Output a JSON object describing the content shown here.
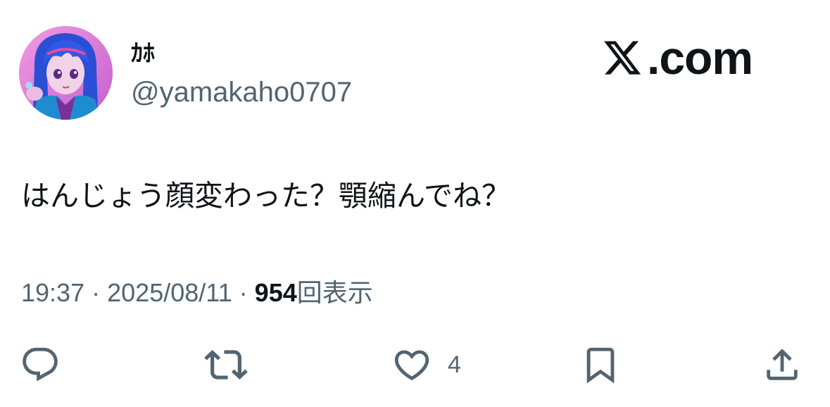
{
  "author": {
    "display_name": "ｶﾎ",
    "handle": "@yamakaho0707",
    "avatar_icon": "anime-avatar-icon"
  },
  "brand": {
    "logo_text": ".com",
    "logo_icon": "x-logo-icon"
  },
  "tweet": {
    "text": "はんじょう顔変わった？顎縮んでね？"
  },
  "meta": {
    "time": "19:37",
    "separator": "·",
    "date": "2025/08/11",
    "views_count": "954",
    "views_label": "回表示"
  },
  "actions": {
    "reply_icon": "reply-icon",
    "retweet_icon": "retweet-icon",
    "like_icon": "heart-icon",
    "like_count": "4",
    "bookmark_icon": "bookmark-icon",
    "share_icon": "share-icon"
  },
  "colors": {
    "text_primary": "#0f1419",
    "text_secondary": "#536471",
    "background": "#ffffff"
  }
}
